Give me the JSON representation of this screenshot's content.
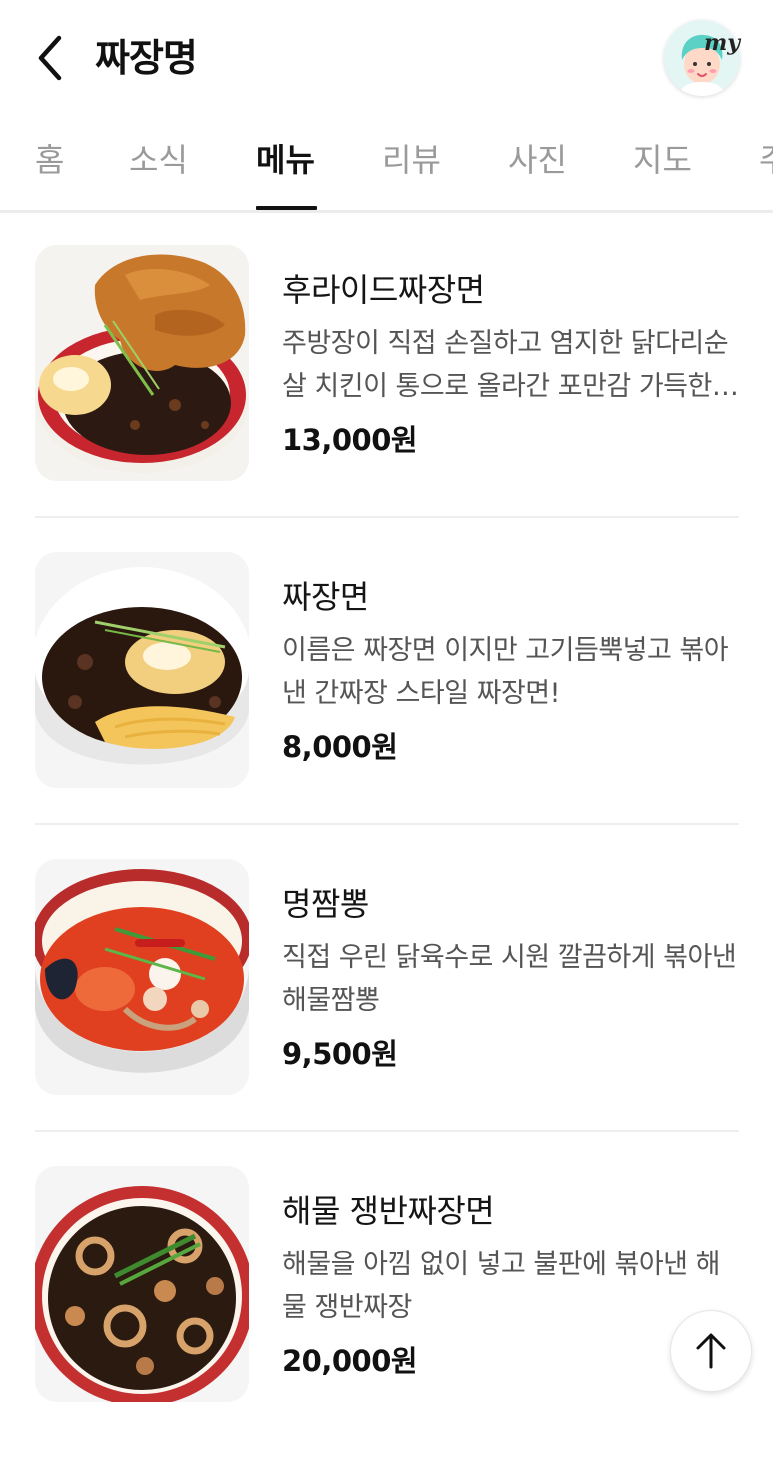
{
  "header": {
    "title": "짜장명",
    "avatar_badge": "my"
  },
  "tabs": [
    {
      "label": "홈",
      "active": false
    },
    {
      "label": "소식",
      "active": false
    },
    {
      "label": "메뉴",
      "active": true
    },
    {
      "label": "리뷰",
      "active": false
    },
    {
      "label": "사진",
      "active": false
    },
    {
      "label": "지도",
      "active": false
    },
    {
      "label": "주",
      "active": false
    }
  ],
  "menu": [
    {
      "name": "후라이드짜장면",
      "description": "주방장이 직접 손질하고 염지한 닭다리순살 치킨이 통으로 올라간 포만감 가득한 짜장면",
      "price": "13,000원"
    },
    {
      "name": "짜장면",
      "description": "이름은 짜장면 이지만 고기듬뿍넣고 볶아낸 간짜장 스타일 짜장면!",
      "price": "8,000원"
    },
    {
      "name": "명짬뽕",
      "description": "직접 우린 닭육수로 시원 깔끔하게 볶아낸 해물짬뽕",
      "price": "9,500원"
    },
    {
      "name": "해물 쟁반짜장면",
      "description": "해물을 아낌 없이 넣고 불판에 볶아낸 해물 쟁반짜장",
      "price": "20,000원"
    }
  ],
  "icons": {
    "back": "chevron-left-icon",
    "scroll_top": "arrow-up-icon"
  },
  "colors": {
    "active_tab": "#111111",
    "inactive_tab": "#9a9a9a",
    "description": "#555555"
  }
}
